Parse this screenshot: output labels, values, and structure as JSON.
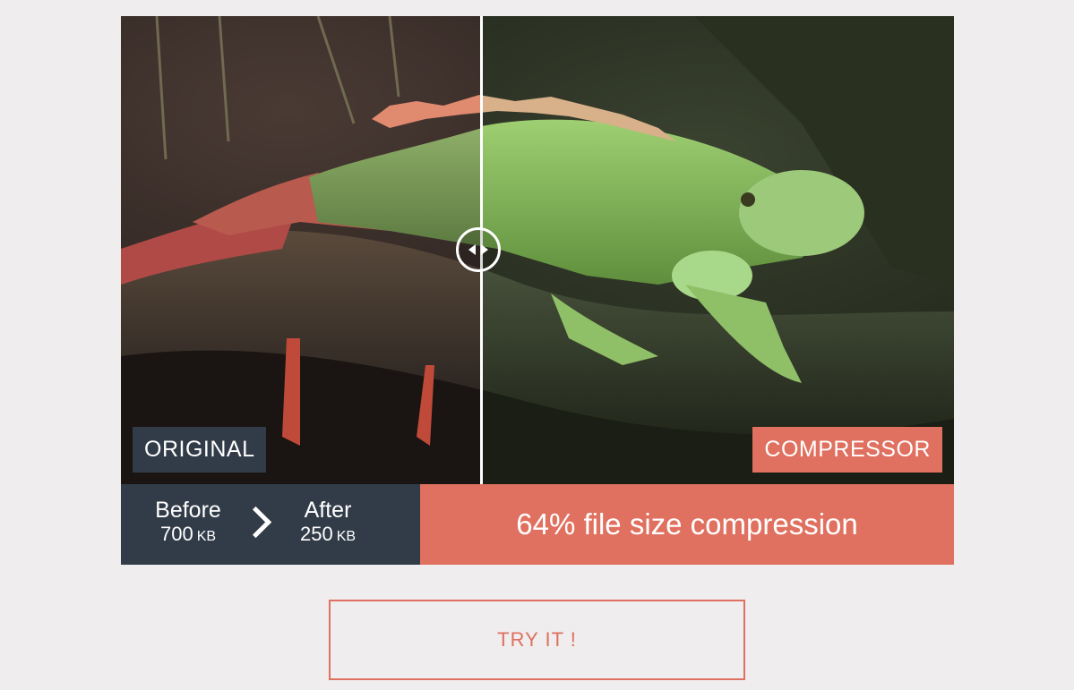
{
  "comparison": {
    "label_original": "ORIGINAL",
    "label_compressor": "COMPRESSOR",
    "slider_position": 0.433
  },
  "stats": {
    "before_label": "Before",
    "before_size": "700",
    "before_unit": "KB",
    "after_label": "After",
    "after_size": "250",
    "after_unit": "KB",
    "compression_text": "64% file size compression"
  },
  "cta": {
    "label": "TRY IT !"
  },
  "colors": {
    "accent": "#e0705f",
    "dark": "#323c48",
    "background": "#efeded"
  }
}
